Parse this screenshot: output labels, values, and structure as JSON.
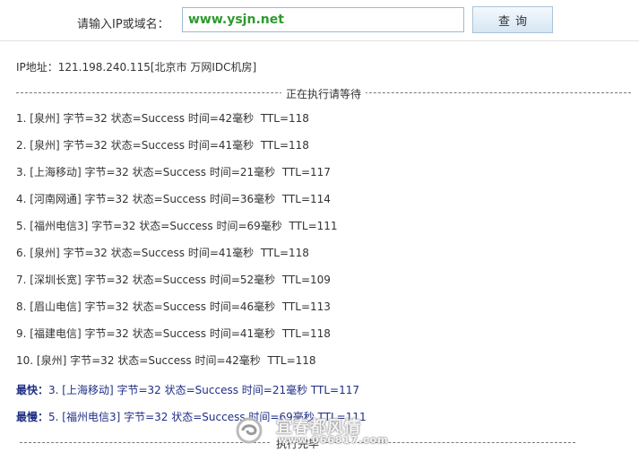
{
  "search": {
    "label": "请输入IP或域名：",
    "value": "www.ysjn.net",
    "button_label": "查询"
  },
  "ip_info": "IP地址：121.198.240.115[北京市 万网IDC机房]",
  "divider_running": "正在执行请等待",
  "results": [
    {
      "index": "1.",
      "location": "[泉州]",
      "bytes": "字节=32",
      "status": "状态=Success",
      "time": "时间=42毫秒",
      "ttl": "TTL=118"
    },
    {
      "index": "2.",
      "location": "[泉州]",
      "bytes": "字节=32",
      "status": "状态=Success",
      "time": "时间=41毫秒",
      "ttl": "TTL=118"
    },
    {
      "index": "3.",
      "location": "[上海移动]",
      "bytes": "字节=32",
      "status": "状态=Success",
      "time": "时间=21毫秒",
      "ttl": "TTL=117"
    },
    {
      "index": "4.",
      "location": "[河南网通]",
      "bytes": "字节=32",
      "status": "状态=Success",
      "time": "时间=36毫秒",
      "ttl": "TTL=114"
    },
    {
      "index": "5.",
      "location": "[福州电信3]",
      "bytes": "字节=32",
      "status": "状态=Success",
      "time": "时间=69毫秒",
      "ttl": "TTL=111"
    },
    {
      "index": "6.",
      "location": "[泉州]",
      "bytes": "字节=32",
      "status": "状态=Success",
      "time": "时间=41毫秒",
      "ttl": "TTL=118"
    },
    {
      "index": "7.",
      "location": "[深圳长宽]",
      "bytes": "字节=32",
      "status": "状态=Success",
      "time": "时间=52毫秒",
      "ttl": "TTL=109"
    },
    {
      "index": "8.",
      "location": "[眉山电信]",
      "bytes": "字节=32",
      "status": "状态=Success",
      "time": "时间=46毫秒",
      "ttl": "TTL=113"
    },
    {
      "index": "9.",
      "location": "[福建电信]",
      "bytes": "字节=32",
      "status": "状态=Success",
      "time": "时间=41毫秒",
      "ttl": "TTL=118"
    },
    {
      "index": "10.",
      "location": "[泉州]",
      "bytes": "字节=32",
      "status": "状态=Success",
      "time": "时间=42毫秒",
      "ttl": "TTL=118"
    }
  ],
  "fastest": {
    "label": "最快：",
    "text": "3. [上海移动] 字节=32 状态=Success 时间=21毫秒 TTL=117"
  },
  "slowest": {
    "label": "最慢：",
    "text": "5. [福州电信3] 字节=32 状态=Success 时间=69毫秒 TTL=111"
  },
  "divider_done": "执行完毕",
  "watermark": {
    "title": "宜春都风情",
    "url": "www.066817.com"
  },
  "colors": {
    "input_text": "#2e9a2e",
    "summary_text": "#1f2e86"
  },
  "icons": {
    "watermark_logo": "swirl-logo-icon"
  }
}
